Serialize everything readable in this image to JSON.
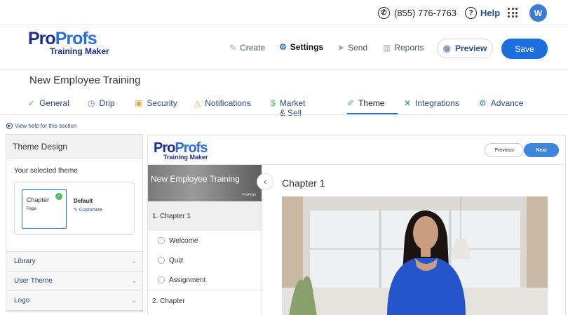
{
  "topbar": {
    "phone": "(855) 776-7763",
    "help": "Help",
    "avatar_initial": "W"
  },
  "brand": {
    "logo_pro1": "Pro",
    "logo_pro2": "Profs",
    "logo_sub": "Training Maker"
  },
  "nav": {
    "create": "Create",
    "settings": "Settings",
    "send": "Send",
    "reports": "Reports",
    "preview": "Preview",
    "save": "Save"
  },
  "course": {
    "title": "New Employee Training"
  },
  "tabs": [
    {
      "label": "General",
      "icon": "check-circle-icon"
    },
    {
      "label": "Drip",
      "icon": "clock-icon"
    },
    {
      "label": "Security",
      "icon": "lock-icon"
    },
    {
      "label": "Notifications",
      "icon": "bell-icon"
    },
    {
      "label": "Market & Sell",
      "icon": "dollar-icon"
    },
    {
      "label": "Theme",
      "icon": "brush-icon"
    },
    {
      "label": "Integrations",
      "icon": "tools-icon"
    },
    {
      "label": "Advance",
      "icon": "gears-icon"
    }
  ],
  "help_link": "View help for this section",
  "panel": {
    "title": "Theme Design",
    "selected_label": "Your selected theme",
    "thumb_title": "Chapter",
    "thumb_sub": "Page",
    "theme_name": "Default",
    "customize": "Customize",
    "sections": [
      "Library",
      "User Theme",
      "Logo"
    ]
  },
  "preview": {
    "prev_label": "Previous",
    "next_label": "Next",
    "banner_title": "New Employee Training",
    "banner_sub": "ProProfs",
    "chapter1": "1. Chapter 1",
    "items": [
      "Welcome",
      "Quiz",
      "Assignment"
    ],
    "chapter2": "2. Chapter",
    "main_title": "Chapter 1"
  },
  "colors": {
    "accent": "#1d6fe0",
    "brand_dark": "#1b2c8f",
    "link": "#2c4a8a"
  }
}
